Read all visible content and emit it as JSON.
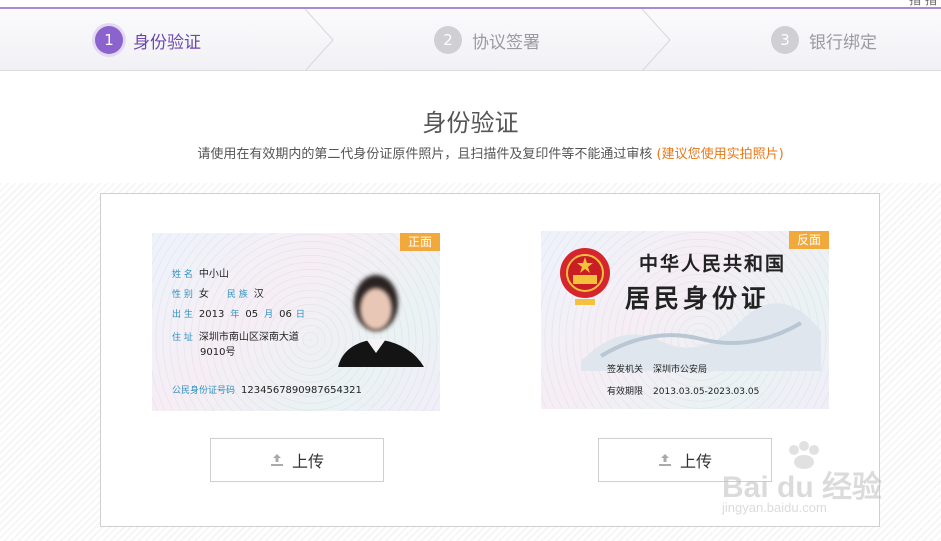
{
  "top_corner": "指 指",
  "steps": [
    {
      "num": "1",
      "label": "身份验证"
    },
    {
      "num": "2",
      "label": "协议签署"
    },
    {
      "num": "3",
      "label": "银行绑定"
    }
  ],
  "header": {
    "title": "身份验证",
    "desc": "请使用在有效期内的第二代身份证原件照片，且扫描件及复印件等不能通过审核",
    "hint": "(建议您使用实拍照片)"
  },
  "front_card": {
    "tag": "正面",
    "name_label": "姓 名",
    "name": "中小山",
    "gender_label": "性 别",
    "gender": "女",
    "ethnic_label": "民 族",
    "ethnic": "汉",
    "birth_label": "出 生",
    "birth_year": "2013",
    "year_label": "年",
    "birth_month": "05",
    "month_label": "月",
    "birth_day": "06",
    "day_label": "日",
    "address_label": "住 址",
    "address1": "深圳市南山区深南大道",
    "address2": "9010号",
    "id_label": "公民身份证号码",
    "id_number": "1234567890987654321"
  },
  "back_card": {
    "tag": "反面",
    "title1": "中华人民共和国",
    "title2": "居民身份证",
    "authority_label": "签发机关",
    "authority": "深圳市公安局",
    "validity_label": "有效期限",
    "validity": "2013.03.05-2023.03.05"
  },
  "upload_front_label": "上传",
  "upload_back_label": "上传",
  "watermark": {
    "brand": "Bai du 经验",
    "url": "jingyan.baidu.com"
  },
  "colors": {
    "accent": "#8c63cc",
    "hint": "#e77817",
    "tag": "#f0a93a"
  }
}
